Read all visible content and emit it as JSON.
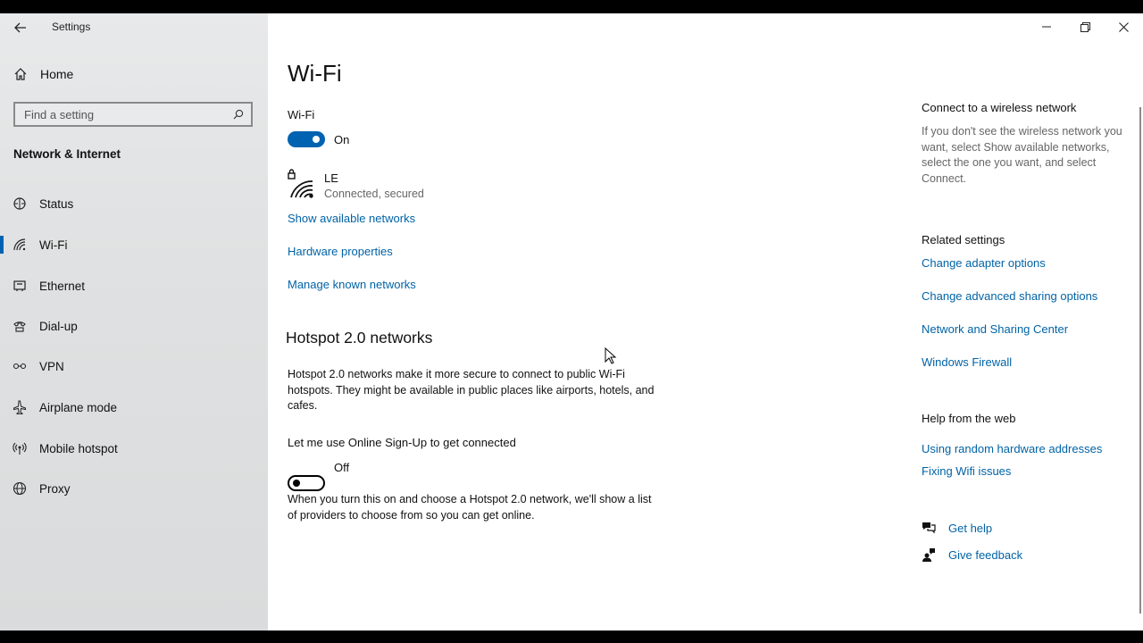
{
  "window": {
    "title": "Settings"
  },
  "sidebar": {
    "home_label": "Home",
    "search_placeholder": "Find a setting",
    "section_title": "Network & Internet",
    "items": [
      {
        "label": "Status",
        "icon": "status-icon"
      },
      {
        "label": "Wi-Fi",
        "icon": "wifi-icon",
        "active": true
      },
      {
        "label": "Ethernet",
        "icon": "ethernet-icon"
      },
      {
        "label": "Dial-up",
        "icon": "dialup-icon"
      },
      {
        "label": "VPN",
        "icon": "vpn-icon"
      },
      {
        "label": "Airplane mode",
        "icon": "airplane-icon"
      },
      {
        "label": "Mobile hotspot",
        "icon": "hotspot-icon"
      },
      {
        "label": "Proxy",
        "icon": "globe-icon"
      }
    ]
  },
  "main": {
    "title": "Wi-Fi",
    "wifi_label": "Wi-Fi",
    "wifi_state": "On",
    "network": {
      "name": "LE",
      "status": "Connected, secured"
    },
    "links": {
      "show_networks": "Show available networks",
      "hardware": "Hardware properties",
      "manage": "Manage known networks"
    },
    "hotspot": {
      "heading": "Hotspot 2.0 networks",
      "description": "Hotspot 2.0 networks make it more secure to connect to public Wi-Fi hotspots. They might be available in public places like airports, hotels, and cafes.",
      "signup_label": "Let me use Online Sign-Up to get connected",
      "signup_state": "Off",
      "note": "When you turn this on and choose a Hotspot 2.0 network, we'll show a list of providers to choose from so you can get online."
    }
  },
  "right": {
    "connect_heading": "Connect to a wireless network",
    "connect_text": "If you don't see the wireless network you want, select Show available networks, select the one you want, and select Connect.",
    "related_heading": "Related settings",
    "related_links": [
      "Change adapter options",
      "Change advanced sharing options",
      "Network and Sharing Center",
      "Windows Firewall"
    ],
    "help_heading": "Help from the web",
    "help_links": [
      "Using random hardware addresses",
      "Fixing Wifi issues"
    ],
    "get_help": "Get help",
    "give_feedback": "Give feedback"
  },
  "colors": {
    "accent": "#0063b1",
    "link": "#0063a6",
    "sidebar_bg": "#dfe1e2"
  }
}
